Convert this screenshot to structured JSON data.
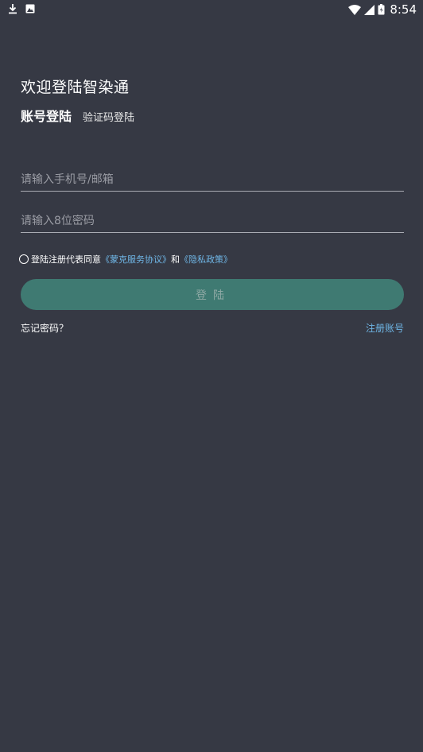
{
  "status_bar": {
    "time": "8:54",
    "left_icons": [
      "download-icon",
      "photo-icon"
    ],
    "right_icons": [
      "wifi-icon",
      "signal-icon",
      "battery-icon"
    ]
  },
  "header": {
    "welcome": "欢迎登陆智染通"
  },
  "tabs": {
    "account_login": "账号登陆",
    "code_login": "验证码登陆"
  },
  "form": {
    "phone_placeholder": "请输入手机号/邮箱",
    "phone_value": "",
    "password_placeholder": "请输入8位密码",
    "password_value": ""
  },
  "agreement": {
    "prefix": "登陆注册代表同意",
    "service_link": "《蒙克服务协议》",
    "joiner": "和",
    "privacy_link": "《隐私政策》",
    "checked": false
  },
  "actions": {
    "login_label": "登陆",
    "forgot_password": "忘记密码？",
    "register": "注册账号"
  },
  "colors": {
    "background": "#363944",
    "button": "#3f7a72",
    "link": "#6fb6e6"
  }
}
